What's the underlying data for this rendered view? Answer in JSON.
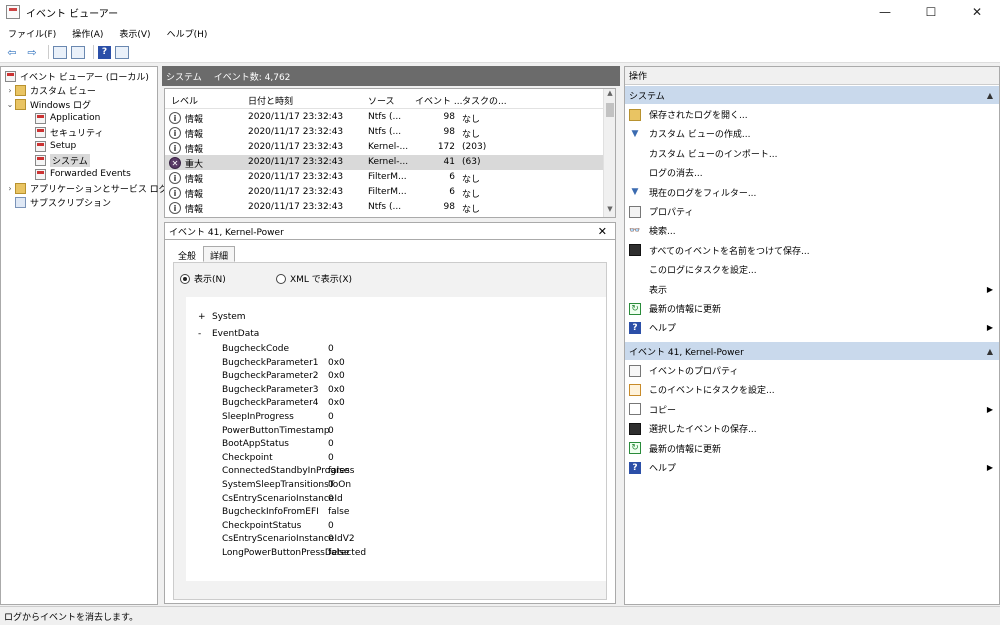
{
  "window": {
    "title": "イベント ビューアー",
    "minimize": "—",
    "maximize": "☐",
    "close": "✕"
  },
  "menu": [
    "ファイル(F)",
    "操作(A)",
    "表示(V)",
    "ヘルプ(H)"
  ],
  "toolbar": {
    "back_glyph": "⇦",
    "forward_glyph": "⇨",
    "help_glyph": "?"
  },
  "tree": {
    "root": "イベント ビューアー (ローカル)",
    "custom_views": "カスタム ビュー",
    "windows_logs": "Windows ログ",
    "logs": [
      "Application",
      "セキュリティ",
      "Setup",
      "システム",
      "Forwarded Events"
    ],
    "apps_services": "アプリケーションとサービス ログ",
    "subscriptions": "サブスクリプション",
    "expand_glyph": "›",
    "expanded_glyph": "⌄"
  },
  "center": {
    "log_name": "システム",
    "event_count": "イベント数: 4,762"
  },
  "events": {
    "columns": [
      "レベル",
      "日付と時刻",
      "ソース",
      "イベント ...",
      "タスクの..."
    ],
    "rows": [
      {
        "level": "情報",
        "datetime": "2020/11/17 23:32:43",
        "source": "Ntfs (...",
        "id": "98",
        "task": "なし",
        "icon": "i",
        "critical": false
      },
      {
        "level": "情報",
        "datetime": "2020/11/17 23:32:43",
        "source": "Ntfs (...",
        "id": "98",
        "task": "なし",
        "icon": "i",
        "critical": false
      },
      {
        "level": "情報",
        "datetime": "2020/11/17 23:32:43",
        "source": "Kernel-...",
        "id": "172",
        "task": "(203)",
        "icon": "i",
        "critical": false
      },
      {
        "level": "重大",
        "datetime": "2020/11/17 23:32:43",
        "source": "Kernel-...",
        "id": "41",
        "task": "(63)",
        "icon": "✕",
        "critical": true
      },
      {
        "level": "情報",
        "datetime": "2020/11/17 23:32:43",
        "source": "FilterM...",
        "id": "6",
        "task": "なし",
        "icon": "i",
        "critical": false
      },
      {
        "level": "情報",
        "datetime": "2020/11/17 23:32:43",
        "source": "FilterM...",
        "id": "6",
        "task": "なし",
        "icon": "i",
        "critical": false
      },
      {
        "level": "情報",
        "datetime": "2020/11/17 23:32:43",
        "source": "Ntfs (...",
        "id": "98",
        "task": "なし",
        "icon": "i",
        "critical": false
      }
    ]
  },
  "detail": {
    "title": "イベント 41, Kernel-Power",
    "close_glyph": "✕",
    "tabs": [
      "全般",
      "詳細"
    ],
    "radio_friendly": "表示(N)",
    "radio_xml": "XML で表示(X)",
    "system_node": "System",
    "eventdata_node": "EventData",
    "plus": "+",
    "minus": "-",
    "fields": [
      {
        "k": "BugcheckCode",
        "v": "0"
      },
      {
        "k": "BugcheckParameter1",
        "v": "0x0"
      },
      {
        "k": "BugcheckParameter2",
        "v": "0x0"
      },
      {
        "k": "BugcheckParameter3",
        "v": "0x0"
      },
      {
        "k": "BugcheckParameter4",
        "v": "0x0"
      },
      {
        "k": "SleepInProgress",
        "v": "0"
      },
      {
        "k": "PowerButtonTimestamp",
        "v": "0"
      },
      {
        "k": "BootAppStatus",
        "v": "0"
      },
      {
        "k": "Checkpoint",
        "v": "0"
      },
      {
        "k": "ConnectedStandbyInProgress",
        "v": "false"
      },
      {
        "k": "SystemSleepTransitionsToOn",
        "v": "0"
      },
      {
        "k": "CsEntryScenarioInstanceId",
        "v": "0"
      },
      {
        "k": "BugcheckInfoFromEFI",
        "v": "false"
      },
      {
        "k": "CheckpointStatus",
        "v": "0"
      },
      {
        "k": "CsEntryScenarioInstanceIdV2",
        "v": "0"
      },
      {
        "k": "LongPowerButtonPressDetected",
        "v": "false"
      }
    ]
  },
  "actions": {
    "header": "操作",
    "section1": "システム",
    "section1_items": [
      {
        "label": "保存されたログを開く...",
        "icon": "open",
        "glyph": "",
        "submenu": false
      },
      {
        "label": "カスタム ビューの作成...",
        "icon": "funnel",
        "glyph": "▼",
        "submenu": false
      },
      {
        "label": "カスタム ビューのインポート...",
        "icon": "blank",
        "glyph": "",
        "submenu": false
      },
      {
        "label": "ログの消去...",
        "icon": "blank",
        "glyph": "",
        "submenu": false
      },
      {
        "label": "現在のログをフィルター...",
        "icon": "funnel",
        "glyph": "▼",
        "submenu": false
      },
      {
        "label": "プロパティ",
        "icon": "props",
        "glyph": "",
        "submenu": false
      },
      {
        "label": "検索...",
        "icon": "find",
        "glyph": "👓",
        "submenu": false
      },
      {
        "label": "すべてのイベントを名前をつけて保存...",
        "icon": "save",
        "glyph": "",
        "submenu": false
      },
      {
        "label": "このログにタスクを設定...",
        "icon": "blank",
        "glyph": "",
        "submenu": false
      },
      {
        "label": "表示",
        "icon": "blank",
        "glyph": "",
        "submenu": true
      },
      {
        "label": "最新の情報に更新",
        "icon": "refresh",
        "glyph": "↻",
        "submenu": false
      },
      {
        "label": "ヘルプ",
        "icon": "help",
        "glyph": "?",
        "submenu": true
      }
    ],
    "section2": "イベント 41, Kernel-Power",
    "section2_items": [
      {
        "label": "イベントのプロパティ",
        "icon": "evprop",
        "glyph": "",
        "submenu": false
      },
      {
        "label": "このイベントにタスクを設定...",
        "icon": "task",
        "glyph": "",
        "submenu": false
      },
      {
        "label": "コピー",
        "icon": "copy",
        "glyph": "",
        "submenu": true
      },
      {
        "label": "選択したイベントの保存...",
        "icon": "save",
        "glyph": "",
        "submenu": false
      },
      {
        "label": "最新の情報に更新",
        "icon": "refresh",
        "glyph": "↻",
        "submenu": false
      },
      {
        "label": "ヘルプ",
        "icon": "help",
        "glyph": "?",
        "submenu": true
      }
    ],
    "caret_up": "▲",
    "submenu_glyph": "▶"
  },
  "status": "ログからイベントを消去します。"
}
